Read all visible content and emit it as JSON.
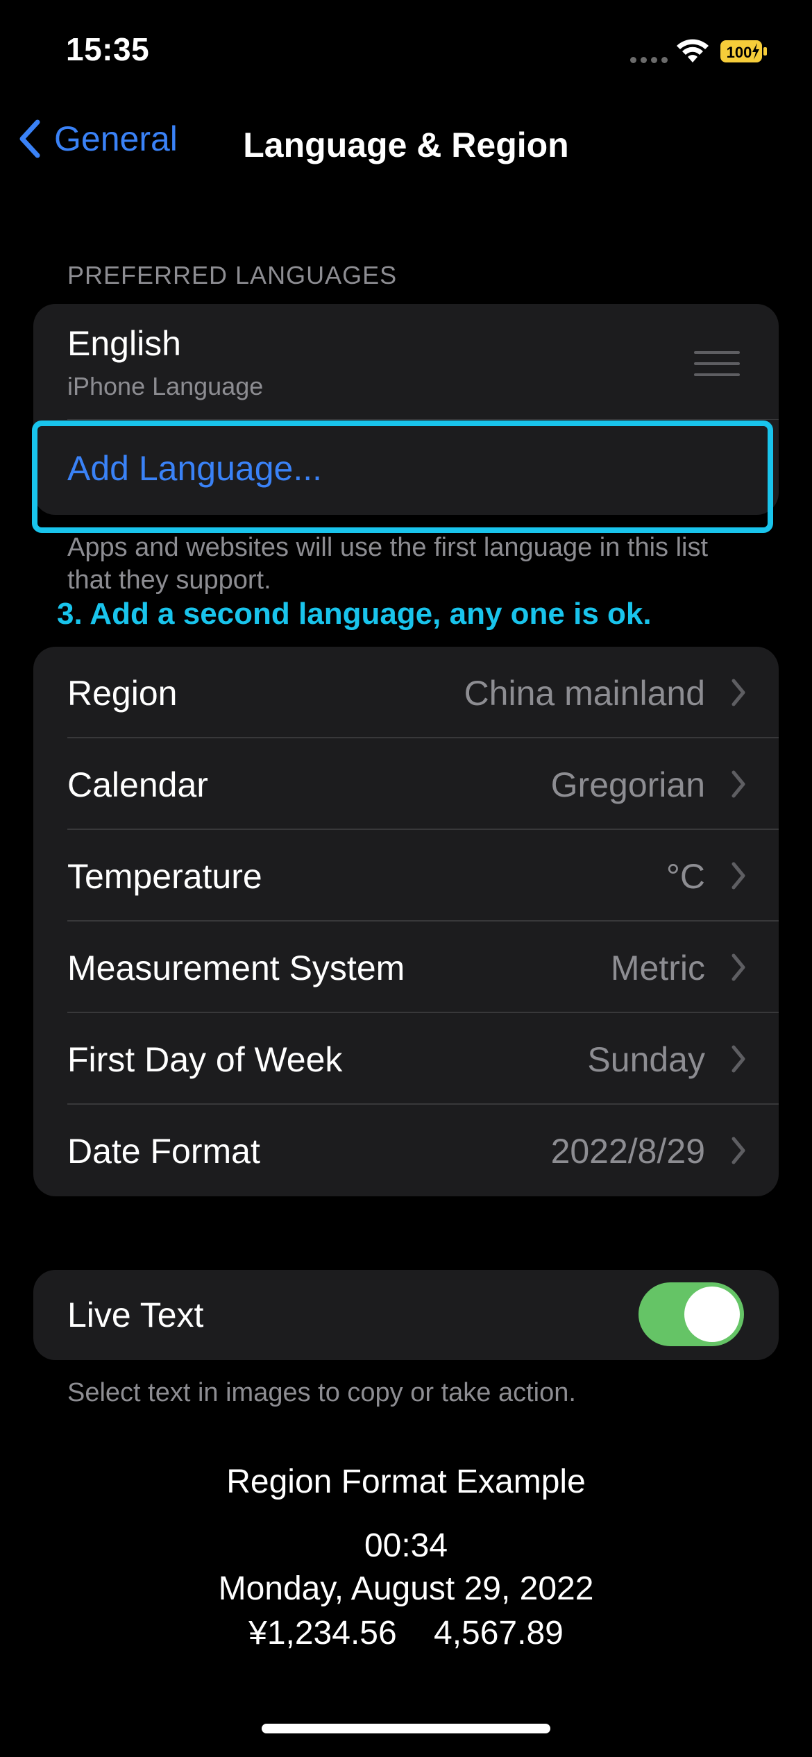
{
  "status_bar": {
    "time": "15:35",
    "battery": "100"
  },
  "nav": {
    "back_label": "General",
    "title": "Language & Region"
  },
  "preferred_languages": {
    "header": "PREFERRED LANGUAGES",
    "primary": {
      "name": "English",
      "subtitle": "iPhone Language"
    },
    "add_label": "Add Language...",
    "footer": "Apps and websites will use the first language in this list that they support."
  },
  "instruction": "3. Add a second language, any one is ok.",
  "settings": [
    {
      "label": "Region",
      "value": "China mainland"
    },
    {
      "label": "Calendar",
      "value": "Gregorian"
    },
    {
      "label": "Temperature",
      "value": "°C"
    },
    {
      "label": "Measurement System",
      "value": "Metric"
    },
    {
      "label": "First Day of Week",
      "value": "Sunday"
    },
    {
      "label": "Date Format",
      "value": "2022/8/29"
    }
  ],
  "live_text": {
    "label": "Live Text",
    "enabled": true,
    "note": "Select text in images to copy or take action."
  },
  "region_example": {
    "title": "Region Format Example",
    "time": "00:34",
    "date": "Monday, August 29, 2022",
    "numbers": "¥1,234.56    4,567.89"
  },
  "colors": {
    "accent": "#3a82f7",
    "highlight": "#19c4ec",
    "toggle_on": "#65c466"
  }
}
